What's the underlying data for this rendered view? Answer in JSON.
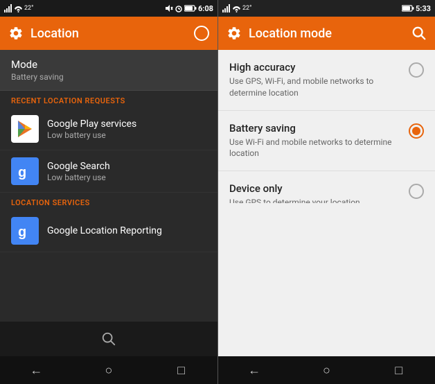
{
  "left_screen": {
    "status_bar": {
      "time": "6:08"
    },
    "app_bar": {
      "title": "Location"
    },
    "mode_section": {
      "title": "Mode",
      "subtitle": "Battery saving"
    },
    "recent_location_requests": {
      "header": "RECENT LOCATION REQUESTS",
      "items": [
        {
          "name": "Google Play services",
          "sub": "Low battery use",
          "icon_type": "gplay"
        },
        {
          "name": "Google Search",
          "sub": "Low battery use",
          "icon_type": "gsearch"
        }
      ]
    },
    "location_services": {
      "header": "LOCATION SERVICES",
      "items": [
        {
          "name": "Google Location Reporting",
          "icon_type": "glocation"
        }
      ]
    },
    "bottom_search_label": "🔍",
    "nav": {
      "back": "←",
      "home": "○",
      "recents": "□"
    }
  },
  "right_screen": {
    "status_bar": {
      "time": "5:33"
    },
    "app_bar": {
      "title": "Location mode"
    },
    "options": [
      {
        "label": "High accuracy",
        "desc": "Use GPS, Wi-Fi, and mobile networks to determine location",
        "selected": false
      },
      {
        "label": "Battery saving",
        "desc": "Use Wi-Fi and mobile networks to determine location",
        "selected": true
      },
      {
        "label": "Device only",
        "desc": "Use GPS to determine your location",
        "selected": false
      }
    ],
    "nav": {
      "back": "←",
      "home": "○",
      "recents": "□"
    }
  }
}
